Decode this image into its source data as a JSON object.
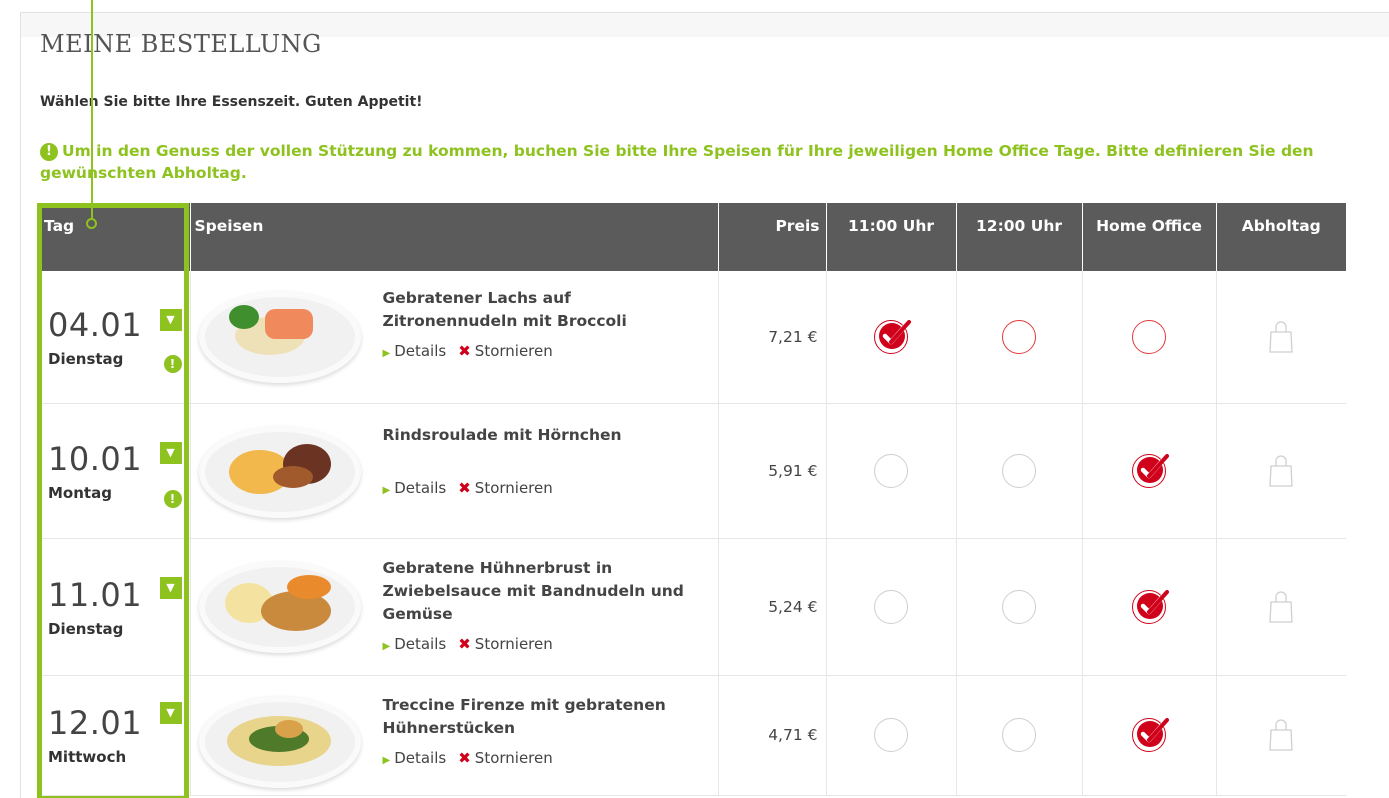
{
  "page": {
    "title": "MEINE BESTELLUNG",
    "intro": "Wählen Sie bitte Ihre Essenszeit. Guten Appetit!",
    "notice_icon": "exclamation-icon",
    "notice": "Um in den Genuss der vollen Stützung zu kommen, buchen Sie bitte Ihre Speisen für Ihre jeweiligen Home Office Tage. Bitte definieren Sie den gewünschten Abholtag."
  },
  "colors": {
    "accent_green": "#8dc21f",
    "header_gray": "#5b5b5b",
    "check_red": "#d0021b"
  },
  "table": {
    "headers": {
      "tag": "Tag",
      "speisen": "Speisen",
      "preis": "Preis",
      "slot1": "11:00 Uhr",
      "slot2": "12:00 Uhr",
      "home": "Home Office",
      "abholtag": "Abholtag"
    },
    "details_label": "Details",
    "cancel_label": "Stornieren",
    "rows": [
      {
        "date": "04.01",
        "weekday": "Dienstag",
        "warning": true,
        "meal": "Gebratener Lachs auf Zitronennudeln mit Broccoli",
        "price": "7,21 €",
        "selection": "11:00 Uhr"
      },
      {
        "date": "10.01",
        "weekday": "Montag",
        "warning": true,
        "meal": "Rindsroulade mit Hörnchen",
        "price": "5,91 €",
        "selection": "Home Office"
      },
      {
        "date": "11.01",
        "weekday": "Dienstag",
        "warning": false,
        "meal": "Gebratene Hühnerbrust in Zwiebelsauce mit Bandnudeln und Gemüse",
        "price": "5,24 €",
        "selection": "Home Office"
      },
      {
        "date": "12.01",
        "weekday": "Mittwoch",
        "warning": false,
        "meal": "Treccine Firenze mit gebratenen Hühnerstücken",
        "price": "4,71 €",
        "selection": "Home Office"
      }
    ]
  }
}
